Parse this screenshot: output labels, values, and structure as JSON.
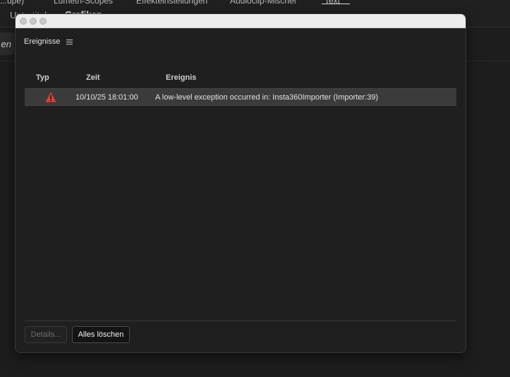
{
  "background_app": {
    "top_tabs": [
      "...upe)",
      "Lumetri-Scopes",
      "Effekteinstellungen",
      "Audioclip-Mischer",
      "Text"
    ],
    "sub_tabs": [
      "Untertitel",
      "Grafiken"
    ],
    "side_button_label": "en"
  },
  "dialog": {
    "panel_title": "Ereignisse",
    "columns": {
      "type": "Typ",
      "time": "Zeit",
      "event": "Ereignis"
    },
    "events": [
      {
        "type_icon": "warning-icon",
        "time": "10/10/25 18:01:00",
        "message": "A low-level exception occurred in: Insta360Importer (Importer:39)"
      }
    ],
    "buttons": {
      "details": "Details...",
      "clear_all": "Alles löschen"
    }
  },
  "colors": {
    "warning": "#e0403a",
    "selected_row": "#3b3b3b",
    "panel_bg": "#1f1f1f"
  }
}
